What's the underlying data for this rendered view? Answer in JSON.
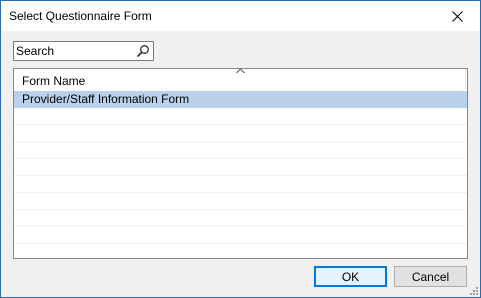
{
  "window": {
    "title": "Select Questionnaire Form",
    "close_icon": "close-icon"
  },
  "search": {
    "placeholder": "Search",
    "value": "",
    "icon": "search-icon"
  },
  "list": {
    "columns": [
      {
        "label": "Form Name",
        "sort": "ascending"
      }
    ],
    "rows": [
      {
        "label": "Provider/Staff Information Form",
        "selected": true
      }
    ],
    "selection_color": "#b9d1ea"
  },
  "buttons": {
    "ok_label": "OK",
    "cancel_label": "Cancel"
  },
  "colors": {
    "accent": "#0078d7",
    "window_border": "#2b6cb0"
  }
}
